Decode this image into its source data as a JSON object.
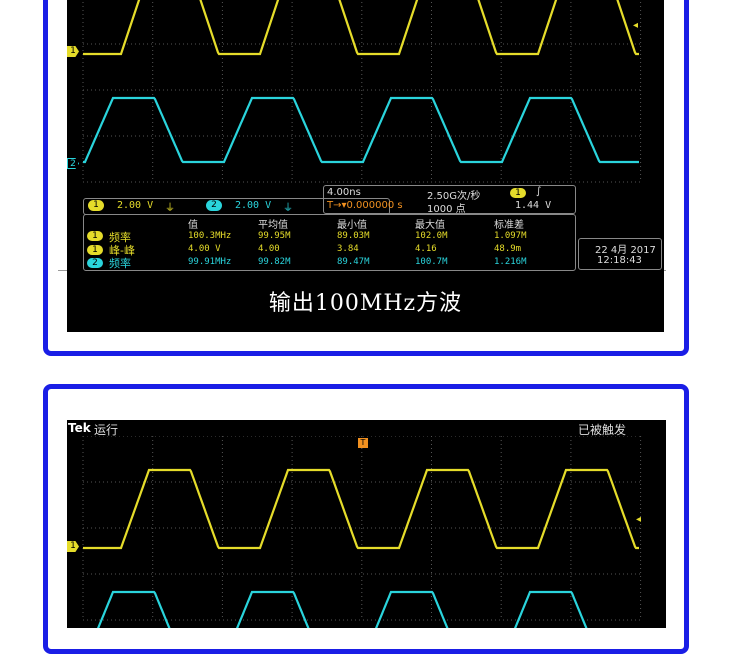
{
  "colors": {
    "ch1": "#e5dc2a",
    "ch2": "#2ad4dc",
    "frame": "#1a1ee6",
    "grid": "#555555"
  },
  "panel1": {
    "ch1_scale": "2.00 V",
    "ch2_scale": "2.00 V",
    "ch1_marker": "1",
    "ch2_marker": "2",
    "timebase": "4.00ns",
    "sample_rate": "2.50G次/秒",
    "record": "1000 点",
    "trigger_level": "1.44 V",
    "trigger_pos": "0.000000 s",
    "date": "22 4月 2017",
    "time": "12:18:43",
    "meas_headers": [
      "值",
      "平均值",
      "最小值",
      "最大值",
      "标准差"
    ],
    "meas_rows": [
      {
        "ch": "1",
        "name": "频率",
        "value": "100.3MHz",
        "mean": "99.95M",
        "min": "89.03M",
        "max": "102.0M",
        "std": "1.097M"
      },
      {
        "ch": "1",
        "name": "峰-峰",
        "value": "4.00 V",
        "mean": "4.00",
        "min": "3.84",
        "max": "4.16",
        "std": "48.9m"
      },
      {
        "ch": "2",
        "name": "频率",
        "value": "99.91MHz",
        "mean": "99.82M",
        "min": "89.47M",
        "max": "100.7M",
        "std": "1.216M"
      }
    ],
    "caption": "输出100MHz方波"
  },
  "panel2": {
    "brand": "Tek",
    "status": "运行",
    "trigger_status": "已被触发",
    "trigger_marker": "T",
    "ch1_marker": "1"
  }
}
